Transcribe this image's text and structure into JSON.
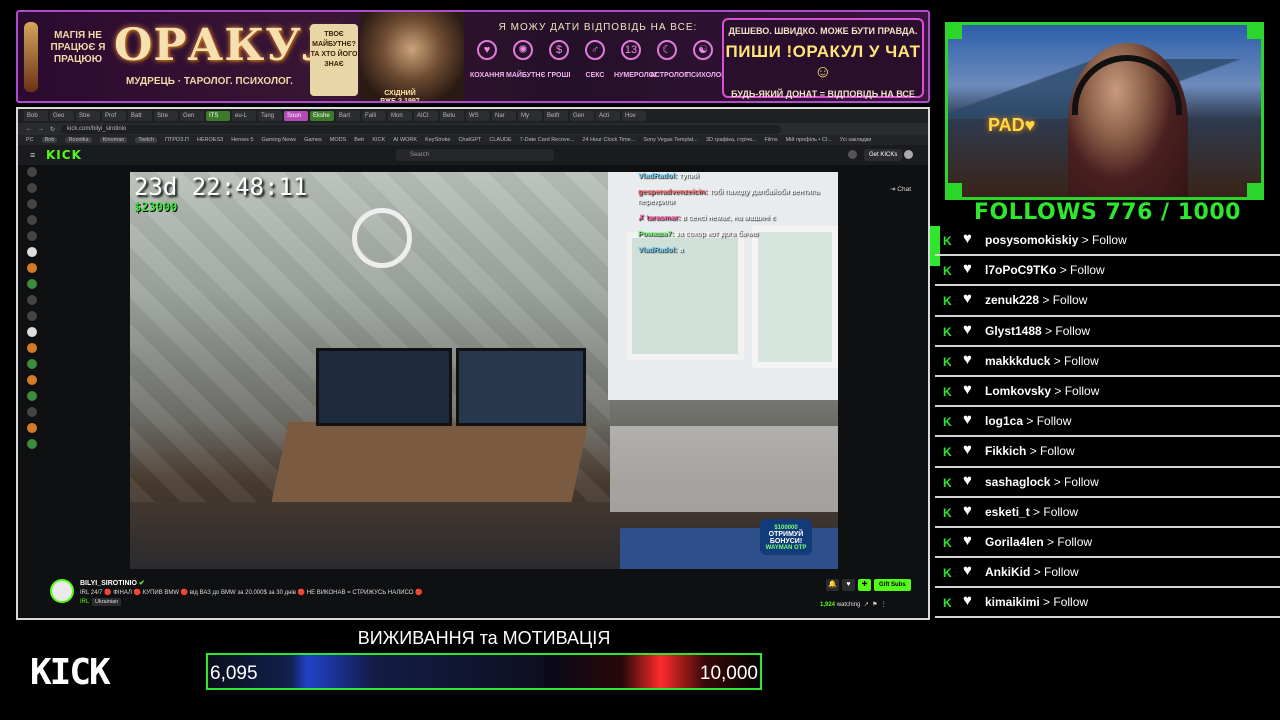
{
  "banner": {
    "side_text": "МАГІЯ НЕ ПРАЦЮЄ Я ПРАЦЮЮ",
    "title": "ОРАКУЛ",
    "tagline": "МУДРЕЦЬ · ТАРОЛОГ. ПСИХОЛОГ.",
    "scroll_text": "ТВОЄ МАЙБУТНЄ? ТА ХТО ЙОГО ЗНАЄ",
    "seal_text": "СХІДНИЙ РЖЕ З 1997",
    "center_title": "Я МОЖУ ДАТИ ВІДПОВІДЬ НА ВСЕ:",
    "categories": [
      {
        "icon": "heart-icon",
        "glyph": "♥",
        "label": "КОХАННЯ"
      },
      {
        "icon": "crystal-ball-icon",
        "glyph": "✺",
        "label": "МАЙБУТНЄ"
      },
      {
        "icon": "money-icon",
        "glyph": "$",
        "label": "ГРОШІ"
      },
      {
        "icon": "apple-icon",
        "glyph": "♂",
        "label": "СЕКС"
      },
      {
        "icon": "numerology-icon",
        "glyph": "13",
        "label": "НУМЕРОЛОГ"
      },
      {
        "icon": "moon-icon",
        "glyph": "☾",
        "label": "АСТРОЛОГ"
      },
      {
        "icon": "brain-icon",
        "glyph": "☯",
        "label": "ПСИХОЛОГ"
      }
    ],
    "promo_top": "ДЕШЕВО. ШВИДКО. МОЖЕ БУТИ ПРАВДА.",
    "promo_main": "ПИШИ !ОРАКУЛ У ЧАТ ☺",
    "promo_bottom": "БУДЬ-ЯКИЙ ДОНАТ = ВІДПОВІДЬ НА ВСЕ"
  },
  "browser": {
    "tabs": [
      "Bob",
      "Geo",
      "Stre",
      "Prof",
      "Batt",
      "Stre",
      "Gen",
      "ITS",
      "eu-L",
      "Tang",
      "Soun",
      "Ekshe",
      "Bart",
      "Falli",
      "Mon",
      "AICI",
      "Betu",
      "WS",
      "Nar",
      "My",
      "Betfr",
      "Gen",
      "Acti",
      "Hov"
    ],
    "url": "kick.com/bilyi_sirotinio",
    "bookmarks": [
      "PC",
      "Bob",
      "Rozetka",
      "Kinoman",
      "Twitch",
      "ПТРОЗ.П",
      "HEROES3",
      "Heroes 5",
      "Gaming News",
      "Games",
      "MODS",
      "Betr",
      "KICK",
      "AI WORK",
      "KeyStroke",
      "ChatGPT",
      "CLAUDE",
      "7-Date Card Recove...",
      "24 Hour Clock Time...",
      "Sony Vegas Templat...",
      "3D графіка, стрічк...",
      "Films",
      "Мій профіль • Cl...",
      "Усі закладки"
    ]
  },
  "kick": {
    "search_placeholder": "Search",
    "get_kicks": "Get KICKs",
    "chat_toggle": "Chat"
  },
  "overlay": {
    "timer": "23d 22:48:11",
    "money": "$23000"
  },
  "chat": [
    {
      "user": "VladRadol:",
      "color": "#7ad8ff",
      "text": "тупий"
    },
    {
      "user": "gesperadvenzeicin:",
      "color": "#ff6b6b",
      "text": "тобі паходу далбайоби вентиль перекрили"
    },
    {
      "user": "✗ tarasmar:",
      "color": "#ff5aa5",
      "text": "в сенсі немає, на машині є"
    },
    {
      "user": "Ромаша7:",
      "color": "#7cff7c",
      "text": "за сохор кот дога бачив"
    },
    {
      "user": "VladRadol:",
      "color": "#7ad8ff",
      "text": "а"
    }
  ],
  "bonus": {
    "amount": "$100000",
    "label": "ОТРИМУЙ БОНУСИ!",
    "sub": "WAYMAN OTP"
  },
  "streamer": {
    "name": "BILYI_SIROTINIO",
    "title": "IRL 24/7 🔴 ФІНАЛ 🔴 КУПИВ BMW 🔴 від ВАЗ до BMW за 20.000$ за 30 днів 🔴 НЕ ВИКОНАВ = СТРИЖУСЬ НАЛИСО 🔴",
    "category": "IRL",
    "tag": "Ukrainian",
    "gift_label": "Gift Subs",
    "viewers": "1,924",
    "watching_label": "watching"
  },
  "follows": {
    "title": "FOLLOWS 776 / 1000",
    "current": 776,
    "goal": 1000,
    "suffix": "> Follow",
    "names": [
      "posysomokiskiy",
      "l7oPoC9TKo",
      "zenuk228",
      "Glyst1488",
      "makkkduck",
      "Lomkovsky",
      "log1ca",
      "Fikkich",
      "sashaglock",
      "esketi_t",
      "Gorila4len",
      "AnkiKid",
      "kimaikimi"
    ]
  },
  "bottom": {
    "kick_logo": "KICK",
    "goal_title": "ВИЖИВАННЯ та МОТИВАЦІЯ",
    "goal_current_label": "6,095",
    "goal_max_label": "10,000",
    "goal_current": 6095,
    "goal_max": 10000
  },
  "colors": {
    "kick_green": "#53fc18",
    "follow_green": "#2fe62f",
    "banner_border": "#b04bd0"
  }
}
